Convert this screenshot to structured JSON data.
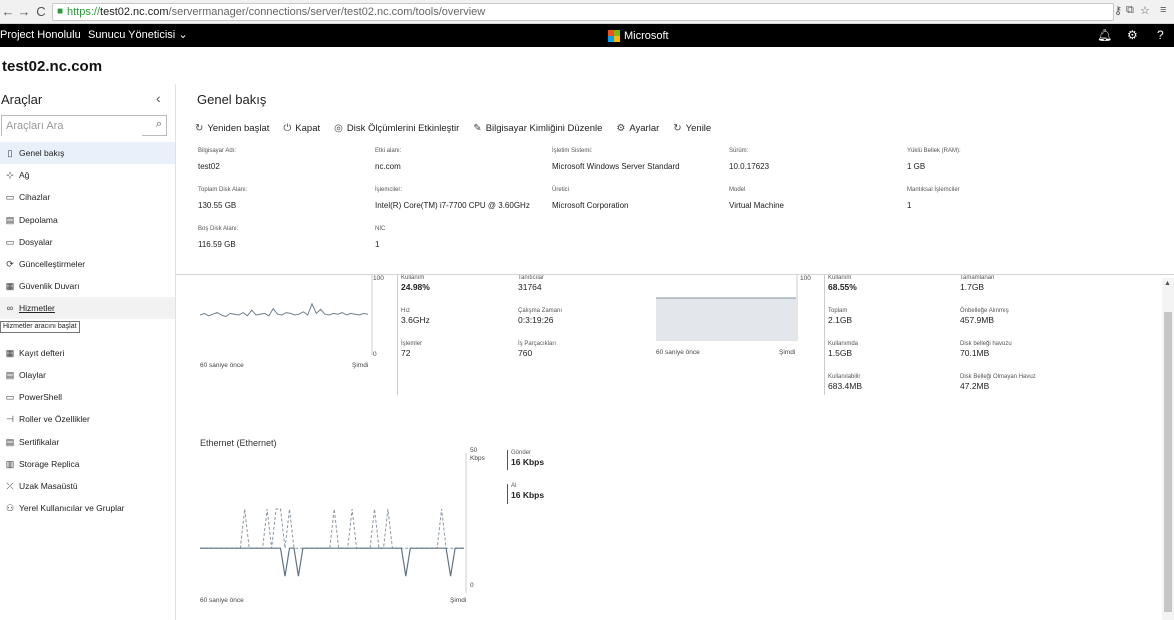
{
  "browser": {
    "url_proto": "https://",
    "url_host": "test02.nc.com",
    "url_path": "/servermanager/connections/server/test02.nc.com/tools/overview"
  },
  "topbar": {
    "product": "Project Honolulu",
    "menu": "Sunucu Yöneticisi",
    "logo_text": "Microsoft",
    "logo_colors": [
      "#f25022",
      "#7fba00",
      "#00a4ef",
      "#ffb900"
    ]
  },
  "server_name": "test02.nc.com",
  "sidebar": {
    "title": "Araçlar",
    "search_placeholder": "Araçları Ara",
    "tooltip": "Hizmetler aracını başlat",
    "items": [
      {
        "label": "Genel bakış",
        "icon": "monitor-icon",
        "glyph": "▯"
      },
      {
        "label": "Ağ",
        "icon": "network-icon",
        "glyph": "⊹"
      },
      {
        "label": "Cihazlar",
        "icon": "devices-icon",
        "glyph": "▭"
      },
      {
        "label": "Depolama",
        "icon": "storage-icon",
        "glyph": "▤"
      },
      {
        "label": "Dosyalar",
        "icon": "files-icon",
        "glyph": "▭"
      },
      {
        "label": "Güncelleştirmeler",
        "icon": "updates-icon",
        "glyph": "⟳"
      },
      {
        "label": "Güvenlik Duvarı",
        "icon": "firewall-icon",
        "glyph": "▦"
      },
      {
        "label": "Hizmetler",
        "icon": "services-icon",
        "glyph": "∞"
      },
      {
        "label": "",
        "icon": "hidden-item-icon",
        "glyph": ""
      },
      {
        "label": "Kayıt defteri",
        "icon": "registry-icon",
        "glyph": "▦"
      },
      {
        "label": "Olaylar",
        "icon": "events-icon",
        "glyph": "▤"
      },
      {
        "label": "PowerShell",
        "icon": "powershell-icon",
        "glyph": "▭"
      },
      {
        "label": "Roller ve Özellikler",
        "icon": "roles-icon",
        "glyph": "⊣"
      },
      {
        "label": "Sertifikalar",
        "icon": "certificates-icon",
        "glyph": "▤"
      },
      {
        "label": "Storage Replica",
        "icon": "storage-replica-icon",
        "glyph": "▥"
      },
      {
        "label": "Uzak Masaüstü",
        "icon": "remote-desktop-icon",
        "glyph": "⤫"
      },
      {
        "label": "Yerel Kullanıcılar ve Gruplar",
        "icon": "users-icon",
        "glyph": "⚇"
      }
    ]
  },
  "main": {
    "title": "Genel bakış",
    "toolbar": [
      {
        "label": "Yeniden başlat",
        "icon": "restart-icon",
        "glyph": "↻"
      },
      {
        "label": "Kapat",
        "icon": "power-icon",
        "glyph": "⏻"
      },
      {
        "label": "Disk Ölçümlerini Etkinleştir",
        "icon": "disk-metrics-icon",
        "glyph": "◎"
      },
      {
        "label": "Bilgisayar Kimliğini Düzenle",
        "icon": "edit-icon",
        "glyph": "✎"
      },
      {
        "label": "Ayarlar",
        "icon": "settings-icon",
        "glyph": "⚙"
      },
      {
        "label": "Yenile",
        "icon": "refresh-icon",
        "glyph": "↻"
      }
    ],
    "properties": [
      {
        "key": "Bilgisayar Adı:",
        "value": "test02"
      },
      {
        "key": "Etki alanı:",
        "value": "nc.com"
      },
      {
        "key": "İşletim Sistemi:",
        "value": "Microsoft Windows Server Standard"
      },
      {
        "key": "Sürüm:",
        "value": "10.0.17623"
      },
      {
        "key": "Yüklü Bellek (RAM):",
        "value": "1 GB"
      },
      {
        "key": "Toplam Disk Alanı:",
        "value": "130.55 GB"
      },
      {
        "key": "İşlemciler:",
        "value": "Intel(R) Core(TM) i7-7700 CPU @ 3.60GHz"
      },
      {
        "key": "Üretici",
        "value": "Microsoft Corporation"
      },
      {
        "key": "Model",
        "value": "Virtual Machine"
      },
      {
        "key": "Mantıksal İşlemciler",
        "value": "1"
      },
      {
        "key": "Boş Disk Alanı:",
        "value": "116.59 GB"
      },
      {
        "key": "NIC",
        "value": "1"
      }
    ]
  },
  "cpu": {
    "y_max": "100",
    "y_min": "0",
    "x_start": "60 saniye önce",
    "x_end": "Şimdi",
    "samples": [
      50,
      52,
      49,
      51,
      53,
      50,
      48,
      52,
      51,
      50,
      53,
      49,
      56,
      50,
      51,
      52,
      49,
      58,
      51,
      50,
      53,
      52,
      50,
      51,
      54,
      50,
      64,
      52,
      57,
      51,
      50,
      52,
      51,
      53,
      50,
      52,
      51,
      50,
      52,
      51
    ],
    "stats": [
      {
        "key": "Kullanım",
        "value": "24.98%",
        "big": true
      },
      {
        "key": "Tanıtıcılar",
        "value": "31764"
      },
      {
        "key": "Hız",
        "value": "3.6GHz"
      },
      {
        "key": "Çalışma Zamanı",
        "value": "0:3:19:26"
      },
      {
        "key": "İşlemler",
        "value": "72"
      },
      {
        "key": "İş Parçacıkları",
        "value": "760"
      }
    ]
  },
  "memory": {
    "y_max": "100",
    "x_start": "60 saniye önce",
    "x_end": "Şimdi",
    "usage_percent": 68.55,
    "stats": [
      {
        "key": "Kullanım",
        "value": "68.55%",
        "big": true
      },
      {
        "key": "Tamamlanan",
        "value": "1.7GB"
      },
      {
        "key": "Toplam",
        "value": "2.1GB"
      },
      {
        "key": "Önbelleğe Alınmış",
        "value": "457.9MB"
      },
      {
        "key": "Kullanımda",
        "value": "1.5GB"
      },
      {
        "key": "Disk belleği havuzu",
        "value": "70.1MB"
      },
      {
        "key": "Kullanılabilir",
        "value": "683.4MB"
      },
      {
        "key": "Disk Belleği Olmayan Havuz",
        "value": "47.2MB"
      }
    ]
  },
  "ethernet": {
    "title": "Ethernet (Ethernet)",
    "y_max": "50",
    "y_unit": "Kbps",
    "y_min": "0",
    "x_start": "60 saniye önce",
    "x_end": "Şimdi",
    "send_label": "Gönder",
    "send_value": "16 Kbps",
    "recv_label": "Al",
    "recv_value": "16 Kbps",
    "send_samples": [
      16,
      16,
      16,
      16,
      16,
      16,
      16,
      16,
      16,
      16,
      30,
      16,
      16,
      16,
      16,
      30,
      16,
      30,
      30,
      16,
      30,
      16,
      16,
      16,
      16,
      16,
      16,
      16,
      16,
      16,
      30,
      16,
      16,
      16,
      30,
      16,
      16,
      16,
      16,
      30,
      16,
      16,
      30,
      16,
      16,
      16,
      16,
      16,
      16,
      16,
      16,
      16,
      16,
      16,
      30,
      16,
      16,
      16,
      16,
      16
    ],
    "recv_samples": [
      16,
      16,
      16,
      16,
      16,
      16,
      16,
      16,
      16,
      16,
      16,
      16,
      16,
      16,
      16,
      16,
      16,
      16,
      16,
      6,
      16,
      16,
      6,
      16,
      16,
      16,
      16,
      16,
      16,
      16,
      16,
      16,
      16,
      16,
      16,
      16,
      16,
      16,
      16,
      16,
      16,
      16,
      16,
      16,
      16,
      16,
      6,
      16,
      16,
      16,
      16,
      16,
      16,
      16,
      16,
      16,
      6,
      16,
      16,
      16
    ]
  }
}
